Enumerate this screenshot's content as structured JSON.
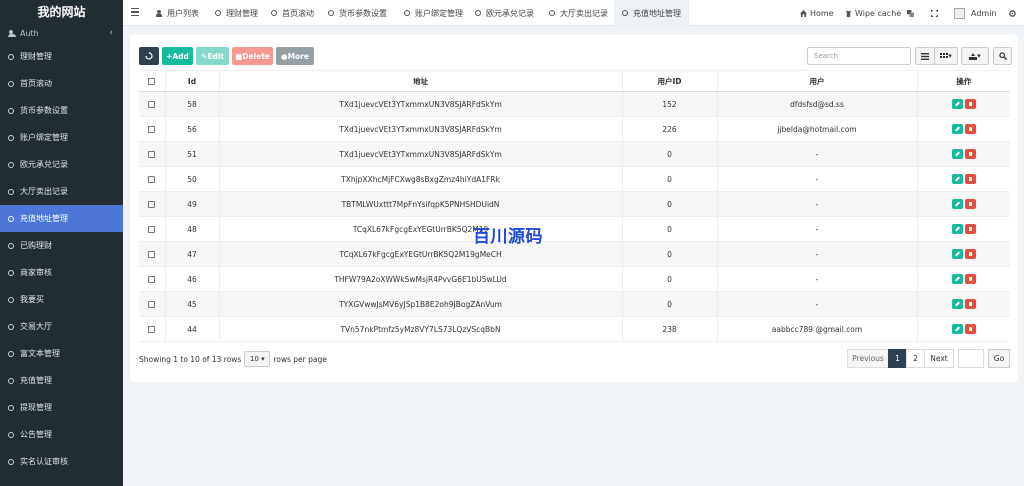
{
  "brand": "我的网站",
  "sidebar": {
    "header": "Auth",
    "collapse_icon": "chevron-left-icon",
    "items": [
      {
        "label": "理财管理",
        "active": false
      },
      {
        "label": "首页滚动",
        "active": false
      },
      {
        "label": "货币参数设置",
        "active": false
      },
      {
        "label": "账户绑定管理",
        "active": false
      },
      {
        "label": "欧元承兑记录",
        "active": false
      },
      {
        "label": "大厅卖出记录",
        "active": false
      },
      {
        "label": "充值地址管理",
        "active": true
      },
      {
        "label": "已购理财",
        "active": false
      },
      {
        "label": "商家审核",
        "active": false
      },
      {
        "label": "我要买",
        "active": false
      },
      {
        "label": "交易大厅",
        "active": false
      },
      {
        "label": "富文本管理",
        "active": false
      },
      {
        "label": "充值管理",
        "active": false
      },
      {
        "label": "提现管理",
        "active": false
      },
      {
        "label": "公告管理",
        "active": false
      },
      {
        "label": "实名认证审核",
        "active": false
      }
    ]
  },
  "topbar": {
    "tabs": [
      {
        "label": "用户列表"
      },
      {
        "label": "理财管理"
      },
      {
        "label": "首页滚动"
      },
      {
        "label": "货币参数设置"
      },
      {
        "label": "账户绑定管理"
      },
      {
        "label": "欧元承兑记录"
      },
      {
        "label": "大厅卖出记录"
      },
      {
        "label": "充值地址管理"
      }
    ],
    "home_label": "Home",
    "wipe_label": "Wipe cache",
    "admin_label": "Admin"
  },
  "toolbar": {
    "add_label": "Add",
    "edit_label": "Edit",
    "delete_label": "Delete",
    "more_label": "More",
    "search_placeholder": "Search"
  },
  "table": {
    "headers": [
      "Id",
      "地址",
      "用户ID",
      "用户",
      "操作"
    ],
    "rows": [
      {
        "id": "58",
        "address": "TXd1juevcVEt3YTxmmxUN3V8SJARFdSkYm",
        "user_id": "152",
        "user": "dfdsfsd@sd.ss"
      },
      {
        "id": "56",
        "address": "TXd1juevcVEt3YTxmmxUN3V8SJARFdSkYm",
        "user_id": "226",
        "user": "jjbelda@hotmail.com"
      },
      {
        "id": "51",
        "address": "TXd1juevcVEt3YTxmmxUN3V8SJARFdSkYm",
        "user_id": "0",
        "user": "-"
      },
      {
        "id": "50",
        "address": "TXhjpXXhcMjFCXwg8sBxgZmz4hiYdA1FRk",
        "user_id": "0",
        "user": "-"
      },
      {
        "id": "49",
        "address": "TBTMLWUxttt7MpFnYsifqpK5PNHSHDUidN",
        "user_id": "0",
        "user": "-"
      },
      {
        "id": "48",
        "address": "TCqXL67kFgcgExYEGtUrrBK5Q2M19",
        "user_id": "0",
        "user": "-"
      },
      {
        "id": "47",
        "address": "TCqXL67kFgcgExYEGtUrrBK5Q2M19gMeCH",
        "user_id": "0",
        "user": "-"
      },
      {
        "id": "46",
        "address": "THFW79A2oXWWkSwMsjR4PvvG6E1bU5wLUd",
        "user_id": "0",
        "user": "-"
      },
      {
        "id": "45",
        "address": "TYXGVwwJsMV6yJSp1B8E2oh9JBogZAnVum",
        "user_id": "0",
        "user": "-"
      },
      {
        "id": "44",
        "address": "TVn57nkPtmfz5yMz8VY7LS73LQzVScqBbN",
        "user_id": "238",
        "user": "aabbcc789 @gmail.com"
      }
    ]
  },
  "footer": {
    "showing_text": "Showing 1 to 10 of 13 rows",
    "page_size": "10",
    "rows_per_page": "rows per page",
    "prev_label": "Previous",
    "page1": "1",
    "page2": "2",
    "next_label": "Next",
    "go_label": "Go"
  },
  "watermark": "百川源码"
}
